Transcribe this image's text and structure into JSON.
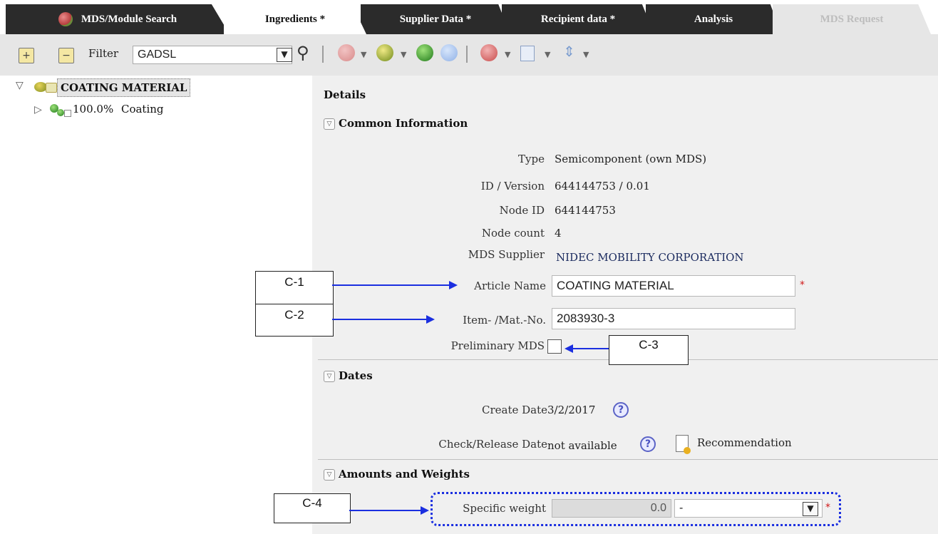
{
  "tabs": [
    {
      "label": "MDS/Module Search",
      "state": "inactive"
    },
    {
      "label": "Ingredients *",
      "state": "active"
    },
    {
      "label": "Supplier Data *",
      "state": "inactive"
    },
    {
      "label": "Recipient data *",
      "state": "inactive"
    },
    {
      "label": "Analysis",
      "state": "inactive"
    },
    {
      "label": "MDS Request",
      "state": "disabled"
    }
  ],
  "toolbar": {
    "filter_label": "Filter",
    "filter_value": "GADSL",
    "icons": [
      "expand-all-icon",
      "collapse-all-icon",
      "search-icon",
      "add-component-icon",
      "add-semicomponent-icon",
      "add-material-icon",
      "add-substance-icon",
      "delete-icon",
      "copy-icon",
      "move-icon"
    ]
  },
  "tree": {
    "root_label": "COATING MATERIAL",
    "children": [
      {
        "percent": "100.0%",
        "label": "Coating"
      }
    ]
  },
  "details": {
    "title": "Details",
    "common": {
      "title": "Common Information",
      "type_label": "Type",
      "type_value": "Semicomponent (own MDS)",
      "id_version_label": "ID / Version",
      "id_version_value": "644144753 / 0.01",
      "node_id_label": "Node ID",
      "node_id_value": "644144753",
      "node_count_label": "Node count",
      "node_count_value": "4",
      "supplier_label": "MDS Supplier",
      "supplier_value": "NIDEC MOBILITY CORPORATION",
      "article_name_label": "Article Name",
      "article_name_value": "COATING MATERIAL",
      "item_no_label": "Item- /Mat.-No.",
      "item_no_value": "2083930-3",
      "preliminary_label": "Preliminary MDS",
      "required_mark": "*"
    },
    "dates": {
      "title": "Dates",
      "create_label": "Create Date",
      "create_value": "3/2/2017",
      "check_label": "Check/Release Date",
      "check_value": "not available",
      "recommendation": "Recommendation",
      "help_glyph": "?"
    },
    "amounts": {
      "title": "Amounts and Weights",
      "specific_weight_label": "Specific weight",
      "specific_weight_value": "0.0",
      "unit_value": "-"
    }
  },
  "callouts": {
    "c1": "C-1",
    "c2": "C-2",
    "c3": "C-3",
    "c4": "C-4"
  },
  "colors": {
    "tab_dark": "#2b2b2b",
    "toolbar_bg": "#e6e6e6",
    "details_bg": "#f0f0f0",
    "callout_arrow": "#1b2fe0",
    "required": "#d01818"
  }
}
